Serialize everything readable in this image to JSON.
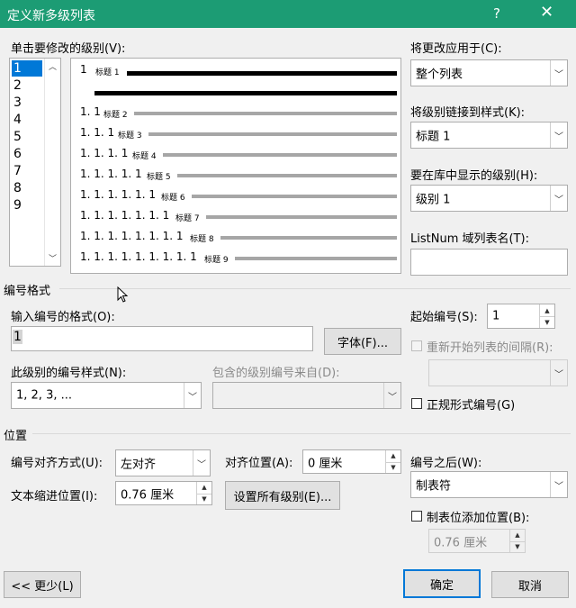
{
  "window": {
    "title": "定义新多级列表",
    "help": "?",
    "close": "✕"
  },
  "level_list": {
    "label": "单击要修改的级别(V):",
    "items": [
      "1",
      "2",
      "3",
      "4",
      "5",
      "6",
      "7",
      "8",
      "9"
    ],
    "selected": "1"
  },
  "preview": {
    "rows": [
      {
        "num": "1",
        "title": "标题 1"
      },
      {
        "num": "1. 1",
        "title": "标题 2"
      },
      {
        "num": "1. 1. 1",
        "title": "标题 3"
      },
      {
        "num": "1. 1. 1. 1",
        "title": "标题 4"
      },
      {
        "num": "1. 1. 1. 1. 1",
        "title": "标题 5"
      },
      {
        "num": "1. 1. 1. 1. 1. 1",
        "title": "标题 6"
      },
      {
        "num": "1. 1. 1. 1. 1. 1. 1",
        "title": "标题 7"
      },
      {
        "num": "1. 1. 1. 1. 1. 1. 1. 1",
        "title": "标题 8"
      },
      {
        "num": "1. 1. 1. 1. 1. 1. 1. 1. 1",
        "title": "标题 9"
      }
    ]
  },
  "right": {
    "apply_to": {
      "label": "将更改应用于(C):",
      "value": "整个列表"
    },
    "link_style": {
      "label": "将级别链接到样式(K):",
      "value": "标题 1"
    },
    "gallery_level": {
      "label": "要在库中显示的级别(H):",
      "value": "级别 1"
    },
    "listnum": {
      "label": "ListNum 域列表名(T):",
      "value": ""
    }
  },
  "number_format": {
    "section": "编号格式",
    "format_label": "输入编号的格式(O):",
    "format_value": "1",
    "font_button": "字体(F)...",
    "style_label": "此级别的编号样式(N):",
    "style_value": "1, 2, 3, ...",
    "include_label": "包含的级别编号来自(D):",
    "include_value": "",
    "start_label": "起始编号(S):",
    "start_value": "1",
    "restart_label": "重新开始列表的间隔(R):",
    "restart_value": "",
    "legal_label": "正规形式编号(G)"
  },
  "position": {
    "section": "位置",
    "align_label": "编号对齐方式(U):",
    "align_value": "左对齐",
    "at_label": "对齐位置(A):",
    "at_value": "0 厘米",
    "indent_label": "文本缩进位置(I):",
    "indent_value": "0.76 厘米",
    "set_all_button": "设置所有级别(E)...",
    "follow_label": "编号之后(W):",
    "follow_value": "制表符",
    "tab_stop_label": "制表位添加位置(B):",
    "tab_stop_value": "0.76 厘米"
  },
  "footer": {
    "less_button": "<< 更少(L)",
    "ok_button": "确定",
    "cancel_button": "取消"
  },
  "colors": {
    "titlebar": "#1c9c74",
    "selection": "#0078d7",
    "dialog_bg": "#f0f0f0"
  }
}
